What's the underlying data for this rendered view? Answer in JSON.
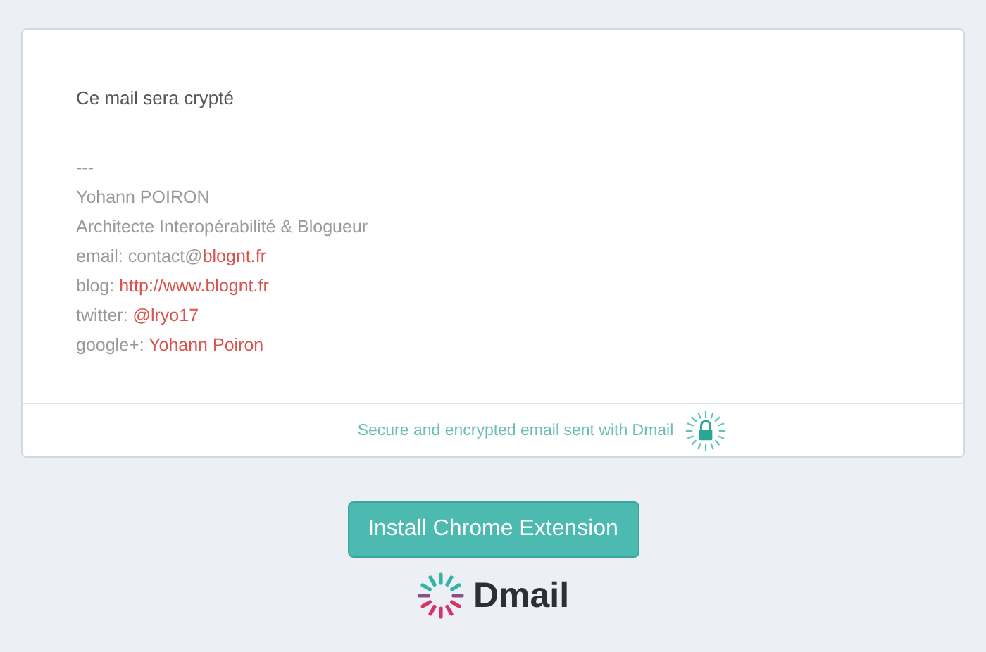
{
  "message": {
    "body": "Ce mail sera crypté",
    "signature": [
      {
        "text": "---"
      },
      {
        "text": "Yohann POIRON"
      },
      {
        "text": "Architecte Interopérabilité & Blogueur"
      },
      {
        "text": "email: contact@",
        "link": "blognt.fr"
      },
      {
        "text": "blog: ",
        "link": "http://www.blognt.fr"
      },
      {
        "text": "twitter: ",
        "link": "@lryo17"
      },
      {
        "text": "google+: ",
        "link": "Yohann Poiron"
      }
    ],
    "footer": "Secure and encrypted email sent with Dmail"
  },
  "install_button": "Install Chrome Extension",
  "brand": "Dmail"
}
